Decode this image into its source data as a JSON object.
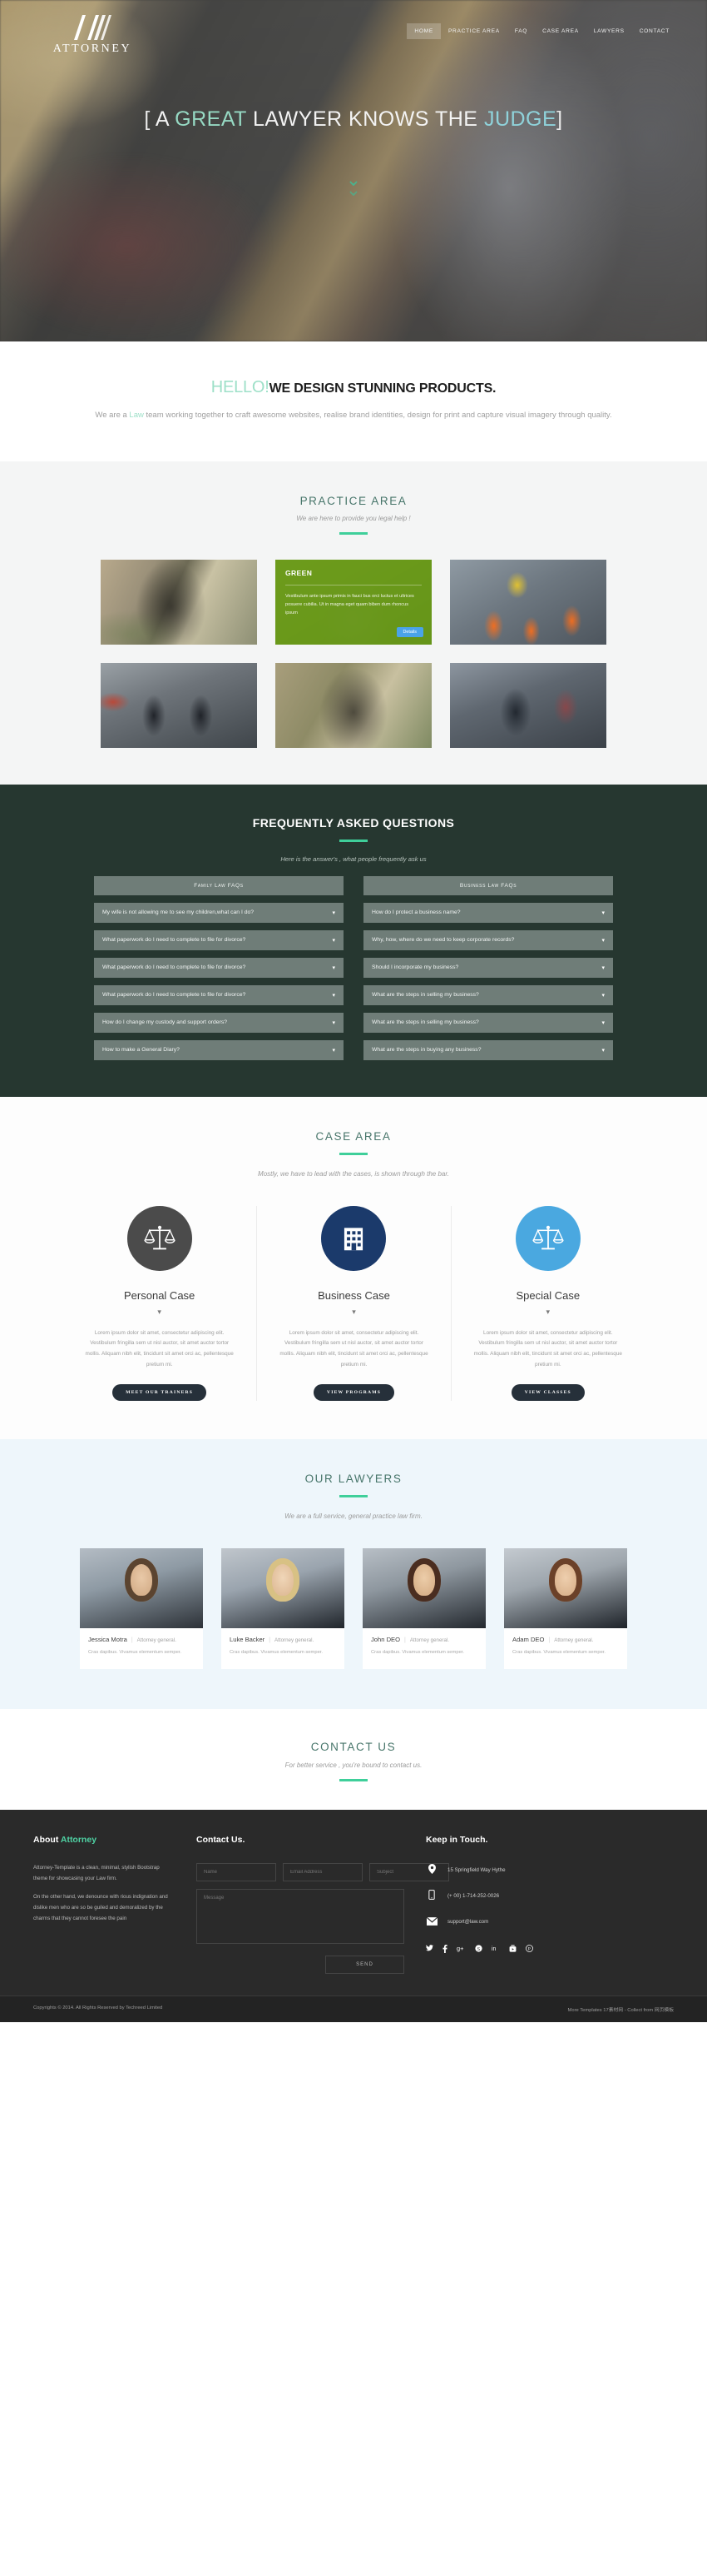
{
  "brand": {
    "name": "ATTORNEY",
    "logo_icon": "double-chevron-a-logo"
  },
  "nav": {
    "items": [
      {
        "label": "HOME",
        "active": true
      },
      {
        "label": "PRACTICE AREA",
        "active": false
      },
      {
        "label": "FAQ",
        "active": false
      },
      {
        "label": "CASE AREA",
        "active": false
      },
      {
        "label": "LAWYERS",
        "active": false
      },
      {
        "label": "CONTACT",
        "active": false
      }
    ]
  },
  "hero": {
    "bracket_open": "[",
    "bracket_close": "]",
    "word1": "A",
    "word2_highlight": "GREAT",
    "word3": "LAWYER KNOWS THE",
    "word4_highlight": "JUDGE",
    "scroll_icon": "chevron-down-double"
  },
  "hello": {
    "greeting": "HELLO!",
    "heading": "WE DESIGN STUNNING PRODUCTS.",
    "paragraph_before": "We are a ",
    "paragraph_accent": "Law",
    "paragraph_after": " team working together to craft awesome websites, realise brand identities, design for print and capture visual imagery through quality."
  },
  "practice": {
    "title": "PRACTICE AREA",
    "subtitle": "We are here to provide you legal help !",
    "cards": [
      {
        "name": "practice-card-photographer-field",
        "overlay": false
      },
      {
        "name": "practice-card-green",
        "overlay": true,
        "overlay_title": "GREEN",
        "overlay_text": "Vestibulum ante ipsum primis in fauci bus orci luctus et ultrices posuere cubilia. Ut in magna eget quam biben dum rhoncus ipsum",
        "overlay_button": "Details"
      },
      {
        "name": "practice-card-construction-cones",
        "overlay": false
      },
      {
        "name": "practice-card-businessmen-street",
        "overlay": false
      },
      {
        "name": "practice-card-camera-hands",
        "overlay": false
      },
      {
        "name": "practice-card-man-winter-coat",
        "overlay": false
      }
    ]
  },
  "faq": {
    "title": "FREQUENTLY ASKED QUESTIONS",
    "subtitle": "Here is the answer's , what people frequently ask us",
    "left_tab": "Family Law FAQs",
    "right_tab": "Business Law FAQs",
    "chevron_icon": "chevron-down-icon",
    "left_items": [
      "My wife is not allowing me to see my children,what can I do?",
      "What paperwork do I need to complete to file for divorce?",
      "What paperwork do I need to complete to file for divorce?",
      "What paperwork do I need to complete to file for divorce?",
      "How do I change my custody and support orders?",
      "How to make a General Diary?"
    ],
    "right_items": [
      "How do I protect a business name?",
      "Why, how, where do we need to keep corporate records?",
      "Should I incorporate my business?",
      "What are the steps in selling my business?",
      "What are the steps in selling my business?",
      "What are the steps in buying any business?"
    ]
  },
  "cases": {
    "title": "CASE AREA",
    "subtitle": "Mostly, we have to lead with the cases, is shown through the bar.",
    "items": [
      {
        "icon": "scales-of-justice-icon",
        "title": "Personal Case",
        "dot": "▾",
        "text": "Lorem ipsum dolor sit amet, consectetur adipiscing elit. Vestibulum fringilla sem ut nisl auctor, sit amet auctor tortor mollis. Aliquam nibh elit, tincidunt sit amet orci ac, pellentesque pretium mi.",
        "button": "MEET OUR TRAINERS",
        "circle_color": "#4b4b4b"
      },
      {
        "icon": "office-building-icon",
        "title": "Business Case",
        "dot": "▾",
        "text": "Lorem ipsum dolor sit amet, consectetur adipiscing elit. Vestibulum fringilla sem ut nisl auctor, sit amet auctor tortor mollis. Aliquam nibh elit, tincidunt sit amet orci ac, pellentesque pretium mi.",
        "button": "VIEW PROGRAMS",
        "circle_color": "#1b3a6b"
      },
      {
        "icon": "scales-of-justice-icon",
        "title": "Special Case",
        "dot": "▾",
        "text": "Lorem ipsum dolor sit amet, consectetur adipiscing elit. Vestibulum fringilla sem ut nisl auctor, sit amet auctor tortor mollis. Aliquam nibh elit, tincidunt sit amet orci ac, pellentesque pretium mi.",
        "button": "VIEW CLASSES",
        "circle_color": "#4aa8e0"
      }
    ]
  },
  "lawyers": {
    "title": "OUR LAWYERS",
    "subtitle": "We are a full service, general practice law firm.",
    "separator": "|",
    "items": [
      {
        "name": "Jessica Motra",
        "role": "Attorney general.",
        "desc": "Cras dapibus. Vivamus elementum semper."
      },
      {
        "name": "Luke Backer",
        "role": "Attorney general.",
        "desc": "Cras dapibus. Vivamus elementum semper."
      },
      {
        "name": "John DEO",
        "role": "Attorney general.",
        "desc": "Cras dapibus. Vivamus elementum semper."
      },
      {
        "name": "Adam DEO",
        "role": "Attorney general.",
        "desc": "Cras dapibus. Vivamus elementum semper."
      }
    ]
  },
  "contact": {
    "title": "CONTACT US",
    "subtitle": "For better service , you're bound to contact us."
  },
  "footer": {
    "about_title_plain": "About ",
    "about_title_accent": "Attorney",
    "about_p1": "Attorney-Template is a clean, minimal, stylish Bootstrap theme for showcasing your Law firm.",
    "about_p2": "On the other hand, we denounce with rious indignation and dislike men who are so be guiled and demoralized by the charms that they cannot foresee the pain",
    "contact_title": "Contact Us",
    "contact_title_dot": ".",
    "name_placeholder": "Name",
    "email_placeholder": "Email Address",
    "subject_placeholder": "Subject",
    "message_placeholder": "Message",
    "send_label": "SEND",
    "touch_title": "Keep in Touch.",
    "touch_items": [
      {
        "icon": "map-pin-icon",
        "text": "15 Springfield Way Hythe"
      },
      {
        "icon": "mobile-phone-icon",
        "text": "(+ 00) 1-714-252-0026"
      },
      {
        "icon": "envelope-icon",
        "text": "support@law.com"
      }
    ],
    "social": [
      {
        "icon": "twitter-icon",
        "glyph": "🐦"
      },
      {
        "icon": "facebook-icon",
        "glyph": "f"
      },
      {
        "icon": "google-plus-icon",
        "glyph": "g+"
      },
      {
        "icon": "skype-icon",
        "glyph": "S"
      },
      {
        "icon": "linkedin-icon",
        "glyph": "in"
      },
      {
        "icon": "youtube-icon",
        "glyph": "▶"
      },
      {
        "icon": "pinterest-icon",
        "glyph": "P"
      }
    ],
    "copyright": "Copyrights © 2014. All Rights Reserved by Techreed Limited",
    "credits": "More Templates 17素材网 - Collect from 网页模板"
  },
  "colors": {
    "accent_green": "#3fcf9a",
    "heading_teal": "#47756a",
    "faq_bg": "#263730",
    "footer_bg": "#2a2a2a"
  }
}
